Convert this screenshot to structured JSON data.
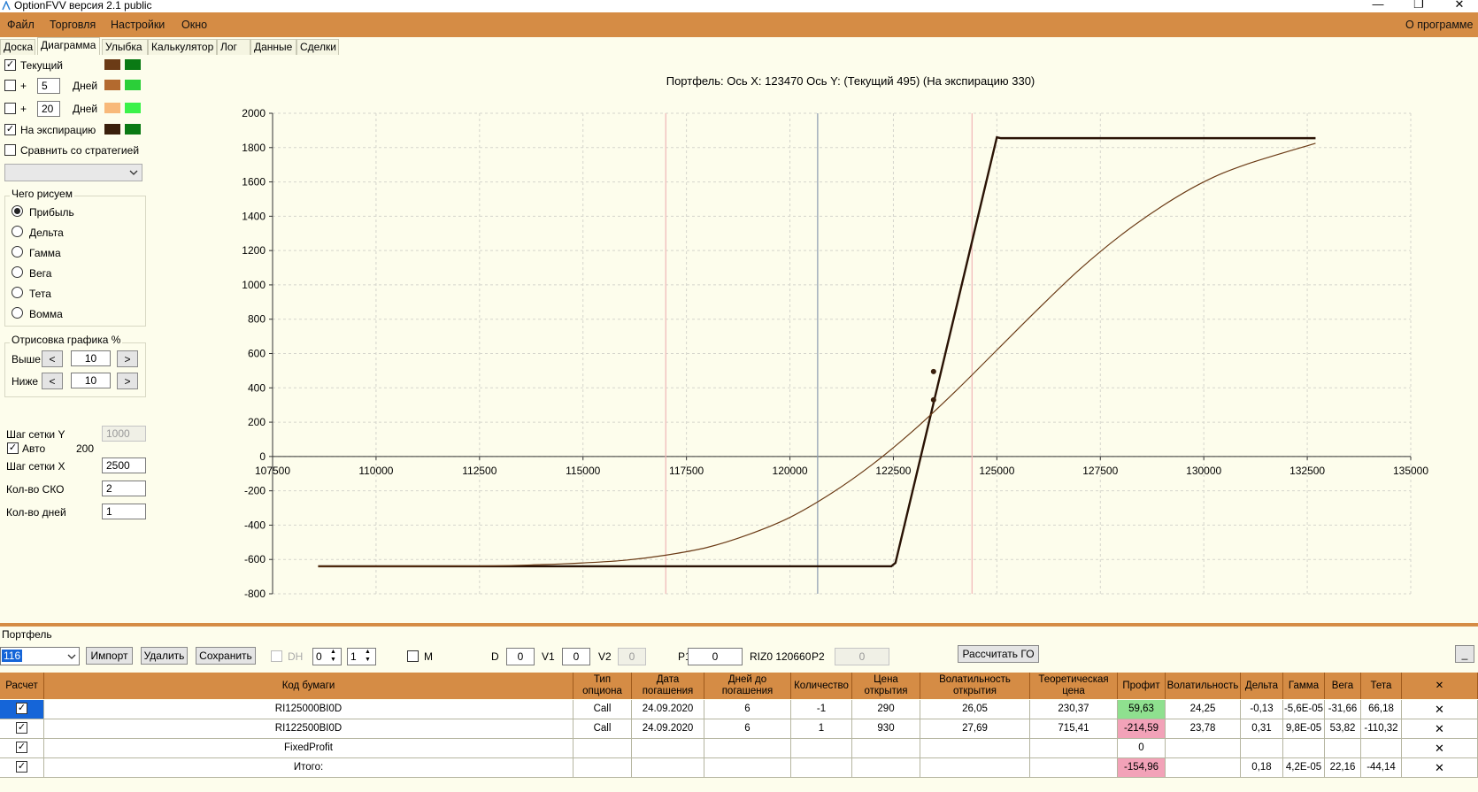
{
  "window": {
    "title": "OptionFVV версия 2.1 public",
    "minimize_glyph": "—",
    "restore_glyph": "❐",
    "close_glyph": "✕"
  },
  "menu": {
    "items": [
      "Файл",
      "Торговля",
      "Настройки",
      "Окно"
    ],
    "about": "О программе"
  },
  "tabs": [
    "Доска",
    "Диаграмма",
    "Улыбка",
    "Калькулятор",
    "Лог",
    "Данные",
    "Сделки"
  ],
  "left_panel": {
    "current_label": "Текущий",
    "plus": "+",
    "days_label": "Дней",
    "days_1": "5",
    "days_2": "20",
    "expiration_label": "На экспирацию",
    "compare_label": "Сравнить со стратегией",
    "what_group": "Чего рисуем",
    "radios": [
      "Прибыль",
      "Дельта",
      "Гамма",
      "Вега",
      "Тета",
      "Вомма"
    ],
    "draw_group": "Отрисовка графика %",
    "above_label": "Выше",
    "below_label": "Ниже",
    "above_value": "10",
    "below_value": "10",
    "prev_glyph": "<",
    "next_glyph": ">",
    "grid_y_label": "Шаг сетки Y",
    "grid_y_value": "1000",
    "auto_label": "Авто",
    "auto_value": "200",
    "grid_x_label": "Шаг сетки X",
    "grid_x_value": "2500",
    "sko_label": "Кол-во СКО",
    "sko_value": "2",
    "days_count_label": "Кол-во дней",
    "days_count_value": "1"
  },
  "colors": {
    "menu_orange": "#d58c45",
    "current_1": "#6b3b16",
    "current_2": "#0a7a14",
    "d5_1": "#b36a2f",
    "d5_2": "#2bcf39",
    "d20_1": "#f8b97a",
    "d20_2": "#3bf24a",
    "exp_1": "#3a1f0b",
    "exp_2": "#0a7a14",
    "profit_pos": "#8fe08f",
    "profit_neg": "#f2a2b8",
    "selected_row": "#1565d8"
  },
  "chart_data": {
    "type": "line",
    "title": "Портфель:  Ось X:  123470 Ось Y:   (Текущий 495)  (На экспирацию 330)",
    "xlim": [
      107500,
      135000
    ],
    "ylim": [
      -800,
      2000
    ],
    "x_ticks": [
      "107500",
      "110000",
      "112500",
      "115000",
      "117500",
      "120000",
      "122500",
      "125000",
      "127500",
      "130000",
      "132500",
      "135000"
    ],
    "y_ticks": [
      "2000",
      "1800",
      "1600",
      "1400",
      "1200",
      "1000",
      "800",
      "600",
      "400",
      "200",
      "0",
      "-200",
      "-400",
      "-600",
      "-800"
    ],
    "grid": true,
    "vertical_lines": [
      {
        "x": 117000,
        "color": "#f0b6b6"
      },
      {
        "x": 120670,
        "color": "#8a9ab0"
      },
      {
        "x": 124400,
        "color": "#f0b6b6"
      }
    ],
    "series": [
      {
        "color": "#2a1305",
        "x": [
          108600,
          122450,
          122550,
          125000,
          125100,
          132700
        ],
        "y": [
          -640,
          -640,
          -620,
          1860,
          1855,
          1855
        ]
      },
      {
        "color": "#6b3b16",
        "x": [
          108600,
          112500,
          114000,
          115000,
          116000,
          117000,
          118000,
          119000,
          120000,
          121000,
          122000,
          123000,
          124000,
          125000,
          126000,
          127000,
          128000,
          129000,
          130000,
          131000,
          132700
        ],
        "y": [
          -640,
          -638,
          -630,
          -620,
          -605,
          -575,
          -530,
          -455,
          -355,
          -215,
          -45,
          155,
          380,
          620,
          860,
          1090,
          1290,
          1460,
          1600,
          1700,
          1825
        ]
      }
    ],
    "points": [
      {
        "x": 123470,
        "y": 495
      },
      {
        "x": 123470,
        "y": 330
      }
    ]
  },
  "portfolio": {
    "label": "Портфель",
    "selected": "116",
    "import_btn": "Импорт",
    "delete_btn": "Удалить",
    "save_btn": "Сохранить",
    "dh_label": "DH",
    "spin1": "0",
    "spin2": "1",
    "m_label": "M",
    "d_label": "D",
    "d_value": "0",
    "v1_label": "V1",
    "v1_value": "0",
    "v2_label": "V2",
    "v2_value": "0",
    "p1_label": "P1",
    "p1_value": "0",
    "riz": "RIZ0 120660",
    "p2_label": "P2",
    "p2_value": "0",
    "calc_btn": "Рассчитать ГО",
    "min_btn": "_",
    "spin_up": "▲",
    "spin_down": "▼",
    "dropdown_glyph": "⌄"
  },
  "table": {
    "headers": [
      "Расчет",
      "Код бумаги",
      "Тип опциона",
      "Дата погашения",
      "Дней до погашения",
      "Количество",
      "Цена открытия",
      "Волатильность открытия",
      "Теоретическая цена",
      "Профит",
      "Волатильность",
      "Дельта",
      "Гамма",
      "Вега",
      "Тета",
      "✕"
    ],
    "rows": [
      {
        "cells": [
          "✓",
          "RI125000BI0D",
          "Call",
          "24.09.2020",
          "6",
          "-1",
          "290",
          "26,05",
          "230,37",
          "59,63",
          "24,25",
          "-0,13",
          "-5,6E-05",
          "-31,66",
          "66,18",
          "✕"
        ],
        "profit": "pos",
        "selected": true
      },
      {
        "cells": [
          "✓",
          "RI122500BI0D",
          "Call",
          "24.09.2020",
          "6",
          "1",
          "930",
          "27,69",
          "715,41",
          "-214,59",
          "23,78",
          "0,31",
          "9,8E-05",
          "53,82",
          "-110,32",
          "✕"
        ],
        "profit": "neg",
        "selected": false
      },
      {
        "cells": [
          "✓",
          "FixedProfit",
          "",
          "",
          "",
          "",
          "",
          "",
          "",
          "0",
          "",
          "",
          "",
          "",
          "",
          "✕"
        ],
        "profit": "none",
        "selected": false
      },
      {
        "cells": [
          "✓",
          "Итого:",
          "",
          "",
          "",
          "",
          "",
          "",
          "",
          "-154,96",
          "",
          "0,18",
          "4,2E-05",
          "22,16",
          "-44,14",
          "✕"
        ],
        "profit": "neg",
        "selected": false
      }
    ]
  }
}
